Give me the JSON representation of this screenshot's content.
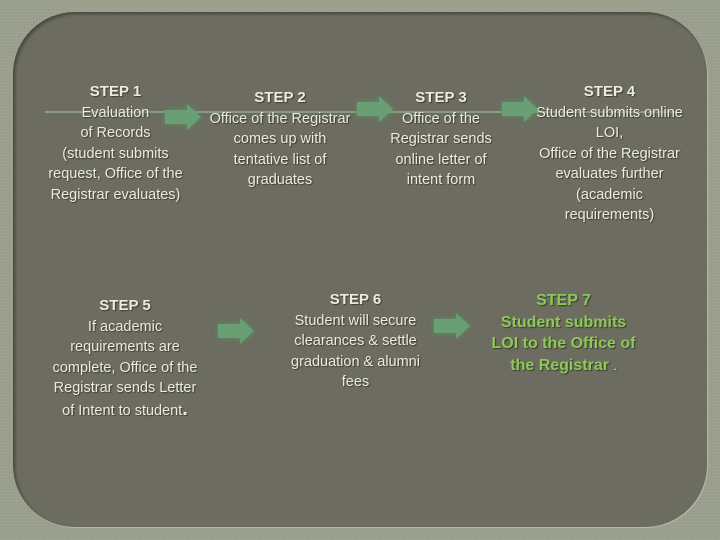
{
  "slide": {
    "steps": [
      {
        "title": "STEP 1",
        "lines": [
          "Evaluation",
          "of Records",
          "(student submits",
          "request, Office of the",
          "Registrar evaluates)"
        ]
      },
      {
        "title": "STEP 2",
        "lines": [
          "Office of the Registrar",
          "comes up with",
          "tentative list of",
          "graduates"
        ]
      },
      {
        "title": "STEP 3",
        "lines": [
          "Office of the",
          "Registrar sends",
          "online letter of",
          "intent form"
        ]
      },
      {
        "title": "STEP 4",
        "lines": [
          "Student submits online",
          "LOI,",
          "Office of the Registrar",
          "evaluates further",
          "(academic",
          "requirements)"
        ]
      },
      {
        "title": "STEP 5",
        "lines": [
          "If academic",
          "requirements are",
          "complete, Office of the",
          "Registrar sends Letter",
          "of Intent to student"
        ],
        "end_mark": "."
      },
      {
        "title": "STEP 6",
        "lines": [
          "Student will secure",
          "clearances & settle",
          "graduation & alumni",
          "fees"
        ]
      },
      {
        "title": "STEP 7",
        "lines": [
          "Student submits",
          "LOI to the Office of",
          "the Registrar"
        ],
        "end_mark": "."
      }
    ],
    "arrows": [
      "arrow-right",
      "arrow-right",
      "arrow-right",
      "arrow-right",
      "arrow-right"
    ],
    "colors": {
      "frame": "#9ba08e",
      "panel": "#6c6c61",
      "text": "#ecebe0",
      "arrow": "#6a9e74",
      "highlight_text": "#8fc85a"
    }
  }
}
